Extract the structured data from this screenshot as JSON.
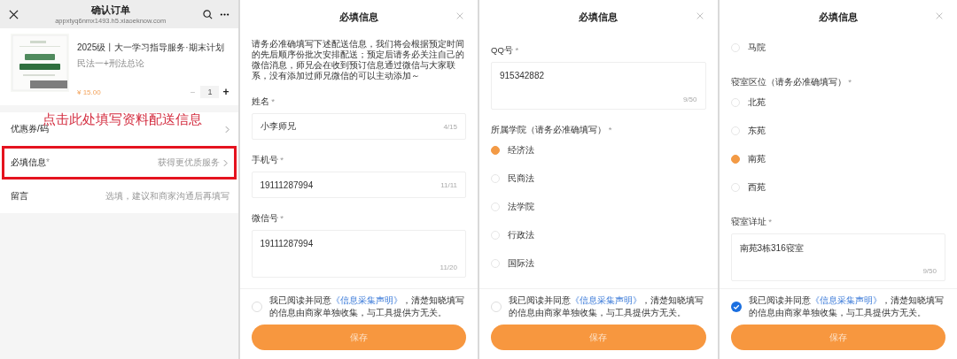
{
  "panels": [
    {
      "kind": "order",
      "header": {
        "title": "确认订单",
        "url": "appxtyq6nmx1493.h5.xiaoeknow.com"
      },
      "product": {
        "title": "2025级丨大一学习指导服务·期末计划",
        "subtitle": "民法一+刑法总论",
        "price": "¥ 15.00",
        "minus": "−",
        "quantity": "1",
        "plus": "+"
      },
      "rows": [
        {
          "label": "优惠券/码",
          "chevron": true,
          "highlighted": false
        },
        {
          "label": "必填信息",
          "mark": "*",
          "value": "获得更优质服务",
          "chevron": true,
          "highlighted": true
        },
        {
          "label": "留言",
          "value": "选填，建议和商家沟通后再填写",
          "chevron": false,
          "highlighted": false
        }
      ],
      "annotation": "点击此处填写资料配送信息"
    },
    {
      "kind": "form",
      "title": "必填信息",
      "items": [
        {
          "kind": "notice",
          "text": "请务必准确填写下述配送信息，我们将会根据预定时间的先后顺序份批次安排配送；预定后请务必关注自己的微信消息，师兄会在收到预订信息通过微信与大家联系，没有添加过师兄微信的可以主动添加～"
        },
        {
          "kind": "input",
          "label": "姓名",
          "mark": "*",
          "value": "小李师兄",
          "counter": "4/15"
        },
        {
          "kind": "input",
          "label": "手机号",
          "mark": "*",
          "value": "19111287994",
          "counter": "11/11"
        },
        {
          "kind": "textarea",
          "label": "微信号",
          "mark": "*",
          "value": "19111287994",
          "counter": "11/20"
        }
      ],
      "agreement": {
        "checked": false,
        "before": "我已阅读并同意",
        "link": "《信息采集声明》",
        "after": "，清楚知晓填写的信息由商家单独收集，与工具提供方无关。"
      },
      "save": "保存"
    },
    {
      "kind": "form",
      "title": "必填信息",
      "items": [
        {
          "kind": "textarea",
          "label": "QQ号",
          "mark": "*",
          "value": "915342882",
          "counter": "9/50"
        },
        {
          "kind": "radio_group",
          "label": "所属学院（请务必准确填写）",
          "mark": "*",
          "options": [
            {
              "label": "经济法",
              "selected": true
            },
            {
              "label": "民商法",
              "selected": false
            },
            {
              "label": "法学院",
              "selected": false
            },
            {
              "label": "行政法",
              "selected": false
            },
            {
              "label": "国际法",
              "selected": false
            }
          ]
        }
      ],
      "agreement": {
        "checked": false,
        "before": "我已阅读并同意",
        "link": "《信息采集声明》",
        "after": "，清楚知晓填写的信息由商家单独收集，与工具提供方无关。"
      },
      "save": "保存"
    },
    {
      "kind": "form",
      "title": "必填信息",
      "items": [
        {
          "kind": "radio_group",
          "options": [
            {
              "label": "马院",
              "selected": false
            }
          ]
        },
        {
          "kind": "radio_group",
          "label": "寝室区位（请务必准确填写）",
          "mark": "*",
          "options": [
            {
              "label": "北苑",
              "selected": false
            },
            {
              "label": "东苑",
              "selected": false
            },
            {
              "label": "南苑",
              "selected": true
            },
            {
              "label": "西苑",
              "selected": false
            }
          ]
        },
        {
          "kind": "textarea",
          "label": "寝室详址",
          "mark": "*",
          "value": "南苑3栋316寝室",
          "counter": "9/50"
        }
      ],
      "agreement": {
        "checked": true,
        "before": "我已阅读并同意",
        "link": "《信息采集声明》",
        "after": "，清楚知晓填写的信息由商家单独收集，与工具提供方无关。"
      },
      "save": "保存"
    }
  ]
}
